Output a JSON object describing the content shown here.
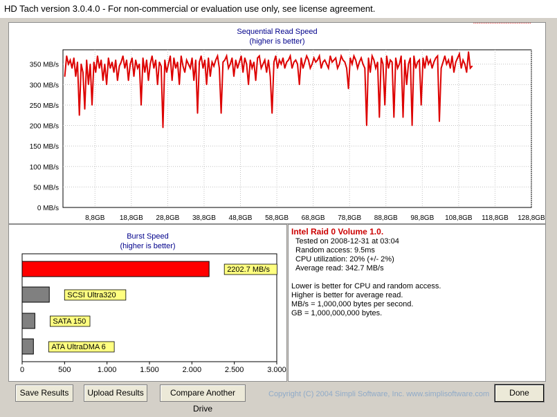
{
  "window": {
    "title": "HD Tach version 3.0.4.0  - For non-commercial or evaluation use only, see license agreement."
  },
  "sequential": {
    "title": "Sequential Read Speed",
    "subtitle": "(higher is better)",
    "chart_data": {
      "type": "line",
      "title": "Sequential Read Speed",
      "subtitle": "(higher is better)",
      "y_unit": "MB/s",
      "ylim": [
        0,
        385
      ],
      "yticks": [
        0,
        50,
        100,
        150,
        200,
        250,
        300,
        350
      ],
      "ytick_labels": [
        "0 MB/s",
        "50 MB/s",
        "100 MB/s",
        "150 MB/s",
        "200 MB/s",
        "250 MB/s",
        "300 MB/s",
        "350 MB/s"
      ],
      "xlim": [
        0,
        128.8
      ],
      "xticks": [
        8.8,
        18.8,
        28.8,
        38.8,
        48.8,
        58.8,
        68.8,
        78.8,
        88.8,
        98.8,
        108.8,
        118.8,
        128.8
      ],
      "xtick_labels": [
        "8,8GB",
        "18,8GB",
        "28,8GB",
        "38,8GB",
        "48,8GB",
        "58,8GB",
        "68,8GB",
        "78,8GB",
        "88,8GB",
        "98,8GB",
        "108,8GB",
        "118,8GB",
        "128,8GB"
      ],
      "grid": true,
      "line_color": "#dd0000",
      "series": [
        {
          "x": [
            0.5,
            1,
            1.5,
            2,
            2.5,
            3,
            3.5,
            4,
            4.5,
            5,
            5.5,
            6,
            6.5,
            7,
            7.5,
            8,
            8.5,
            9,
            9.5,
            10,
            10.5,
            11,
            11.5,
            12,
            12.5,
            13,
            13.5,
            14,
            14.5,
            15,
            15.5,
            16,
            16.5,
            17,
            17.5,
            18,
            18.5,
            19,
            19.5,
            20,
            20.5,
            21,
            21.5,
            22,
            22.5,
            23,
            23.5,
            24,
            24.5,
            25,
            25.5,
            26,
            26.5,
            27,
            27.5,
            28,
            28.5,
            29,
            29.5,
            30,
            30.5,
            31,
            31.5,
            32,
            32.5,
            33,
            33.5,
            34,
            34.5,
            35,
            35.5,
            36,
            36.5,
            37,
            37.5,
            38,
            38.5,
            39,
            39.5,
            40,
            40.5,
            41,
            41.5,
            42,
            42.5,
            43,
            43.5,
            44,
            44.5,
            45,
            45.5,
            46,
            46.5,
            47,
            47.5,
            48,
            48.5,
            49,
            49.5,
            50,
            50.5,
            51,
            51.5,
            52,
            52.5,
            53,
            53.5,
            54,
            54.5,
            55,
            55.5,
            56,
            56.5,
            57,
            57.5,
            58,
            58.5,
            59,
            59.5,
            60,
            60.5,
            61,
            61.5,
            62,
            62.5,
            63,
            63.5,
            64,
            64.5,
            65,
            65.5,
            66,
            66.5,
            67,
            67.5,
            68,
            68.5,
            69,
            69.5,
            70,
            70.5,
            71,
            71.5,
            72,
            72.5,
            73,
            73.5,
            74,
            74.5,
            75,
            75.5,
            76,
            76.5,
            77,
            77.5,
            78,
            78.5,
            79,
            79.5,
            80,
            80.5,
            81,
            81.5,
            82,
            82.5,
            83,
            83.5,
            84,
            84.5,
            85,
            85.5,
            86,
            86.5,
            87,
            87.5,
            88,
            88.5,
            89,
            89.5,
            90,
            90.5,
            91,
            91.5,
            92,
            92.5,
            93,
            93.5,
            94,
            94.5,
            95,
            95.5,
            96,
            96.5,
            97,
            97.5,
            98,
            98.5,
            99,
            99.5,
            100,
            100.5,
            101,
            101.5,
            102,
            102.5,
            103,
            103.5,
            104,
            104.5,
            105,
            105.5,
            106,
            106.5,
            107,
            107.5,
            108,
            108.5,
            109,
            109.5,
            110,
            110.5,
            111,
            111.5,
            112,
            112.5,
            113,
            113.5,
            114,
            114.5,
            115,
            115.5,
            116,
            116.5,
            117,
            117.5,
            118,
            118.5,
            119,
            119.5,
            120,
            120.5,
            121,
            121.5,
            122,
            122.5,
            123,
            123.5,
            124,
            124.5,
            125,
            125.5,
            126,
            126.5,
            127,
            127.5,
            128,
            128.5
          ],
          "y": [
            320,
            370,
            350,
            360,
            340,
            365,
            320,
            355,
            225,
            350,
            330,
            240,
            360,
            300,
            350,
            250,
            355,
            330,
            370,
            340,
            360,
            310,
            350,
            300,
            365,
            340,
            355,
            330,
            360,
            310,
            345,
            355,
            370,
            340,
            360,
            310,
            350,
            365,
            320,
            360,
            340,
            350,
            250,
            365,
            330,
            360,
            310,
            350,
            370,
            340,
            360,
            300,
            355,
            345,
            195,
            360,
            330,
            350,
            370,
            310,
            365,
            340,
            355,
            300,
            370,
            345,
            330,
            360,
            350,
            340,
            365,
            310,
            360,
            230,
            355,
            370,
            340,
            360,
            300,
            365,
            320,
            355,
            345,
            360,
            370,
            340,
            230,
            355,
            360,
            370,
            340,
            350,
            365,
            320,
            360,
            340,
            355,
            370,
            330,
            365,
            350,
            300,
            360,
            340,
            355,
            310,
            365,
            370,
            340,
            350,
            360,
            330,
            360,
            320,
            230,
            355,
            370,
            340,
            360,
            350,
            365,
            340,
            355,
            360,
            370,
            340,
            355,
            360,
            350,
            300,
            365,
            340,
            355,
            370,
            360,
            340,
            350,
            365,
            355,
            360,
            370,
            340,
            355,
            360,
            350,
            340,
            370,
            355,
            360,
            365,
            340,
            350,
            370,
            360,
            355,
            340,
            290,
            365,
            350,
            370,
            360,
            340,
            355,
            365,
            350,
            340,
            200,
            365,
            330,
            370,
            360,
            340,
            355,
            220,
            365,
            350,
            250,
            370,
            340,
            360,
            355,
            220,
            365,
            340,
            350,
            370,
            220,
            360,
            300,
            350,
            365,
            200,
            370,
            340,
            355,
            360,
            250,
            365,
            340,
            370,
            350,
            360,
            340,
            355,
            365,
            370,
            210,
            340,
            355,
            370,
            350,
            360,
            340,
            370,
            330,
            355,
            365,
            375,
            340,
            360,
            350,
            330,
            380,
            340,
            345
          ]
        }
      ]
    }
  },
  "burst": {
    "title": "Burst Speed",
    "subtitle": "(higher is better)",
    "chart_data": {
      "type": "bar",
      "orientation": "horizontal",
      "title": "Burst Speed",
      "subtitle": "(higher is better)",
      "categories": [
        "2202.7 MB/s",
        "SCSI Ultra320",
        "SATA 150",
        "ATA UltraDMA 6"
      ],
      "values": [
        2202.7,
        320,
        150,
        133
      ],
      "colors": [
        "#ff0000",
        "#808080",
        "#808080",
        "#808080"
      ],
      "xlim": [
        0,
        3000
      ],
      "xticks": [
        0,
        500,
        1000,
        1500,
        2000,
        2500,
        3000
      ],
      "xtick_labels": [
        "0",
        "500",
        "1.000",
        "1.500",
        "2.000",
        "2.500",
        "3.000"
      ],
      "label_background": "#ffff80"
    }
  },
  "info": {
    "title": "Intel Raid 0 Volume 1.0.",
    "tested": "Tested on 2008-12-31 at 03:04",
    "random_access": "Random access: 9.5ms",
    "cpu": "CPU utilization: 20% (+/- 2%)",
    "average": "Average read: 342.7 MB/s",
    "note1": "Lower is better for CPU and random access.",
    "note2": "Higher is better for average read.",
    "note3": "MB/s = 1,000,000 bytes per second.",
    "note4": "GB = 1,000,000,000 bytes."
  },
  "buttons": {
    "save": "Save Results",
    "upload": "Upload Results",
    "compare": "Compare Another Drive",
    "done": "Done"
  },
  "copyright": "Copyright (C) 2004 Simpli Software, Inc. www.simplisoftware.com"
}
